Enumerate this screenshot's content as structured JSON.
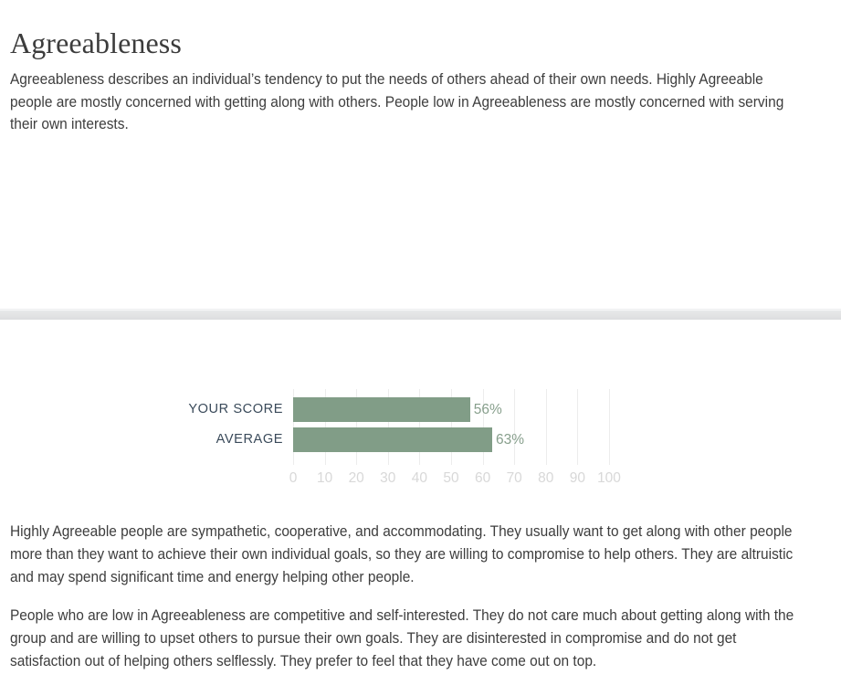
{
  "trait": {
    "title": "Agreeableness",
    "intro": "Agreeableness describes an individual’s tendency to put the needs of others ahead of their own needs. Highly Agreeable people are mostly concerned with getting along with others. People low in Agreeableness are mostly concerned with serving their own interests."
  },
  "chart_data": {
    "type": "bar",
    "orientation": "horizontal",
    "title": "",
    "xlabel": "",
    "ylabel": "",
    "xlim": [
      0,
      100
    ],
    "grid": true,
    "legend": false,
    "categories": [
      "YOUR SCORE",
      "AVERAGE"
    ],
    "values": [
      56,
      63
    ],
    "value_labels": [
      "56%",
      "63%"
    ],
    "ticks": [
      0,
      10,
      20,
      30,
      40,
      50,
      60,
      70,
      80,
      90,
      100
    ],
    "tick_labels": [
      "0",
      "10",
      "20",
      "30",
      "40",
      "50",
      "60",
      "70",
      "80",
      "90",
      "100"
    ],
    "bar_color": "#819d87",
    "value_label_color": "#879f8c",
    "category_label_color": "#3a4a5a",
    "tick_label_color": "#d8d8d8",
    "gridline_color": "#ececec"
  },
  "body": {
    "paragraphs": [
      "Highly Agreeable people are sympathetic, cooperative, and accommodating. They usually want to get along with other people more than they want to achieve their own individual goals, so they are willing to compromise to help others. They are altruistic and may spend significant time and energy helping other people.",
      "People who are low in Agreeableness are competitive and self-interested. They do not care much about getting along with the group and are willing to upset others to pursue their own goals. They are disinterested in compromise and do not get satisfaction out of helping others selflessly. They prefer to feel that they have come out on top."
    ]
  }
}
